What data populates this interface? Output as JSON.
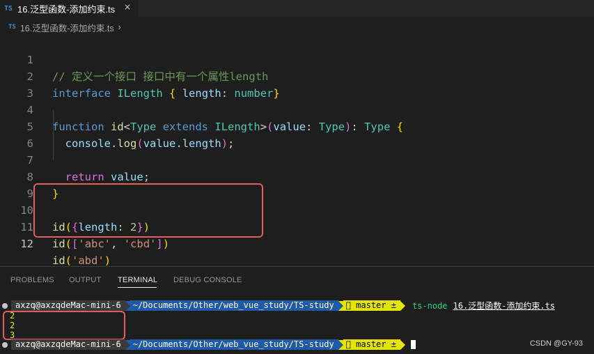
{
  "tab": {
    "badge": "TS",
    "title": "16.泛型函数-添加约束.ts",
    "close": "×"
  },
  "breadcrumb": {
    "badge": "TS",
    "file": "16.泛型函数-添加约束.ts",
    "chevron": "›"
  },
  "editor": {
    "line_numbers": [
      "1",
      "2",
      "3",
      "4",
      "5",
      "6",
      "7",
      "8",
      "9",
      "10",
      "11",
      "12"
    ],
    "active_line": "12",
    "code": {
      "l1": {
        "comment": "// 定义一个接口 接口中有一个属性length"
      },
      "l2": {
        "kw": "interface",
        "name": "ILength",
        "open": "{",
        "prop": "length",
        "colon": ":",
        "type": "number",
        "close": "}"
      },
      "l4": {
        "kw": "function",
        "name": "id",
        "lt": "<",
        "tparam": "Type",
        "extends": "extends",
        "bound": "ILength",
        "gt": ">",
        "popen": "(",
        "param": "value",
        "colon": ":",
        "ptype": "Type",
        "pclose": ")",
        "colon2": ":",
        "rtype": "Type",
        "bopen": "{"
      },
      "l5": {
        "obj": "console",
        "dot": ".",
        "fn": "log",
        "open": "(",
        "arg": "value",
        "dot2": ".",
        "prop": "length",
        "close": ")",
        "semi": ";"
      },
      "l7": {
        "kw": "return",
        "val": "value",
        "semi": ";"
      },
      "l8": {
        "close": "}"
      },
      "l10": {
        "fn": "id",
        "open": "(",
        "bopen": "{",
        "prop": "length",
        "colon": ":",
        "num": "2",
        "bclose": "}",
        "close": ")"
      },
      "l11": {
        "fn": "id",
        "open": "(",
        "aopen": "[",
        "s1": "'abc'",
        "comma": ",",
        "s2": "'cbd'",
        "aclose": "]",
        "close": ")"
      },
      "l12": {
        "fn": "id",
        "open": "(",
        "s1": "'abd'",
        "close": ")"
      }
    }
  },
  "panel": {
    "tabs": [
      "PROBLEMS",
      "OUTPUT",
      "TERMINAL",
      "DEBUG CONSOLE"
    ],
    "active_tab": "TERMINAL"
  },
  "terminal": {
    "user": "axzq@axzqdeMac-mini-6",
    "path": "~/Documents/Other/web_vue_study/TS-study",
    "branch": " master ±",
    "command": "ts-node",
    "argument": "16.泛型函数-添加约束.ts",
    "output": [
      "2",
      "2",
      "3"
    ]
  },
  "watermark": "CSDN @GY-93",
  "colors": {
    "highlight_box": "#e35d5d",
    "terminal_path_bg": "#1f5aa6",
    "terminal_git_bg": "#e5e500",
    "terminal_command": "#23d18b"
  }
}
